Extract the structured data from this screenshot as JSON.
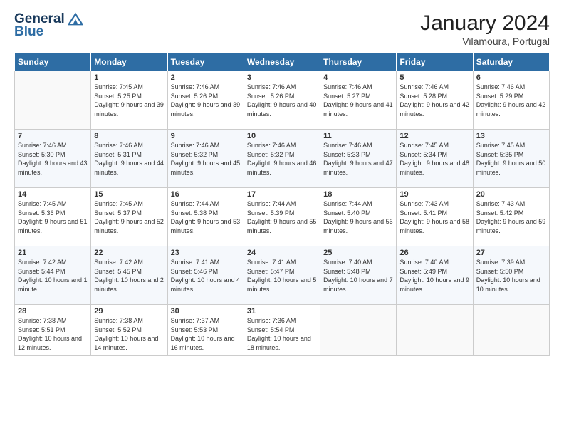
{
  "header": {
    "logo_line1": "General",
    "logo_line2": "Blue",
    "month_year": "January 2024",
    "location": "Vilamoura, Portugal"
  },
  "weekdays": [
    "Sunday",
    "Monday",
    "Tuesday",
    "Wednesday",
    "Thursday",
    "Friday",
    "Saturday"
  ],
  "weeks": [
    [
      {
        "day": "",
        "sunrise": "",
        "sunset": "",
        "daylight": ""
      },
      {
        "day": "1",
        "sunrise": "7:45 AM",
        "sunset": "5:25 PM",
        "daylight": "9 hours and 39 minutes."
      },
      {
        "day": "2",
        "sunrise": "7:46 AM",
        "sunset": "5:26 PM",
        "daylight": "9 hours and 39 minutes."
      },
      {
        "day": "3",
        "sunrise": "7:46 AM",
        "sunset": "5:26 PM",
        "daylight": "9 hours and 40 minutes."
      },
      {
        "day": "4",
        "sunrise": "7:46 AM",
        "sunset": "5:27 PM",
        "daylight": "9 hours and 41 minutes."
      },
      {
        "day": "5",
        "sunrise": "7:46 AM",
        "sunset": "5:28 PM",
        "daylight": "9 hours and 42 minutes."
      },
      {
        "day": "6",
        "sunrise": "7:46 AM",
        "sunset": "5:29 PM",
        "daylight": "9 hours and 42 minutes."
      }
    ],
    [
      {
        "day": "7",
        "sunrise": "7:46 AM",
        "sunset": "5:30 PM",
        "daylight": "9 hours and 43 minutes."
      },
      {
        "day": "8",
        "sunrise": "7:46 AM",
        "sunset": "5:31 PM",
        "daylight": "9 hours and 44 minutes."
      },
      {
        "day": "9",
        "sunrise": "7:46 AM",
        "sunset": "5:32 PM",
        "daylight": "9 hours and 45 minutes."
      },
      {
        "day": "10",
        "sunrise": "7:46 AM",
        "sunset": "5:32 PM",
        "daylight": "9 hours and 46 minutes."
      },
      {
        "day": "11",
        "sunrise": "7:46 AM",
        "sunset": "5:33 PM",
        "daylight": "9 hours and 47 minutes."
      },
      {
        "day": "12",
        "sunrise": "7:45 AM",
        "sunset": "5:34 PM",
        "daylight": "9 hours and 48 minutes."
      },
      {
        "day": "13",
        "sunrise": "7:45 AM",
        "sunset": "5:35 PM",
        "daylight": "9 hours and 50 minutes."
      }
    ],
    [
      {
        "day": "14",
        "sunrise": "7:45 AM",
        "sunset": "5:36 PM",
        "daylight": "9 hours and 51 minutes."
      },
      {
        "day": "15",
        "sunrise": "7:45 AM",
        "sunset": "5:37 PM",
        "daylight": "9 hours and 52 minutes."
      },
      {
        "day": "16",
        "sunrise": "7:44 AM",
        "sunset": "5:38 PM",
        "daylight": "9 hours and 53 minutes."
      },
      {
        "day": "17",
        "sunrise": "7:44 AM",
        "sunset": "5:39 PM",
        "daylight": "9 hours and 55 minutes."
      },
      {
        "day": "18",
        "sunrise": "7:44 AM",
        "sunset": "5:40 PM",
        "daylight": "9 hours and 56 minutes."
      },
      {
        "day": "19",
        "sunrise": "7:43 AM",
        "sunset": "5:41 PM",
        "daylight": "9 hours and 58 minutes."
      },
      {
        "day": "20",
        "sunrise": "7:43 AM",
        "sunset": "5:42 PM",
        "daylight": "9 hours and 59 minutes."
      }
    ],
    [
      {
        "day": "21",
        "sunrise": "7:42 AM",
        "sunset": "5:44 PM",
        "daylight": "10 hours and 1 minute."
      },
      {
        "day": "22",
        "sunrise": "7:42 AM",
        "sunset": "5:45 PM",
        "daylight": "10 hours and 2 minutes."
      },
      {
        "day": "23",
        "sunrise": "7:41 AM",
        "sunset": "5:46 PM",
        "daylight": "10 hours and 4 minutes."
      },
      {
        "day": "24",
        "sunrise": "7:41 AM",
        "sunset": "5:47 PM",
        "daylight": "10 hours and 5 minutes."
      },
      {
        "day": "25",
        "sunrise": "7:40 AM",
        "sunset": "5:48 PM",
        "daylight": "10 hours and 7 minutes."
      },
      {
        "day": "26",
        "sunrise": "7:40 AM",
        "sunset": "5:49 PM",
        "daylight": "10 hours and 9 minutes."
      },
      {
        "day": "27",
        "sunrise": "7:39 AM",
        "sunset": "5:50 PM",
        "daylight": "10 hours and 10 minutes."
      }
    ],
    [
      {
        "day": "28",
        "sunrise": "7:38 AM",
        "sunset": "5:51 PM",
        "daylight": "10 hours and 12 minutes."
      },
      {
        "day": "29",
        "sunrise": "7:38 AM",
        "sunset": "5:52 PM",
        "daylight": "10 hours and 14 minutes."
      },
      {
        "day": "30",
        "sunrise": "7:37 AM",
        "sunset": "5:53 PM",
        "daylight": "10 hours and 16 minutes."
      },
      {
        "day": "31",
        "sunrise": "7:36 AM",
        "sunset": "5:54 PM",
        "daylight": "10 hours and 18 minutes."
      },
      {
        "day": "",
        "sunrise": "",
        "sunset": "",
        "daylight": ""
      },
      {
        "day": "",
        "sunrise": "",
        "sunset": "",
        "daylight": ""
      },
      {
        "day": "",
        "sunrise": "",
        "sunset": "",
        "daylight": ""
      }
    ]
  ]
}
